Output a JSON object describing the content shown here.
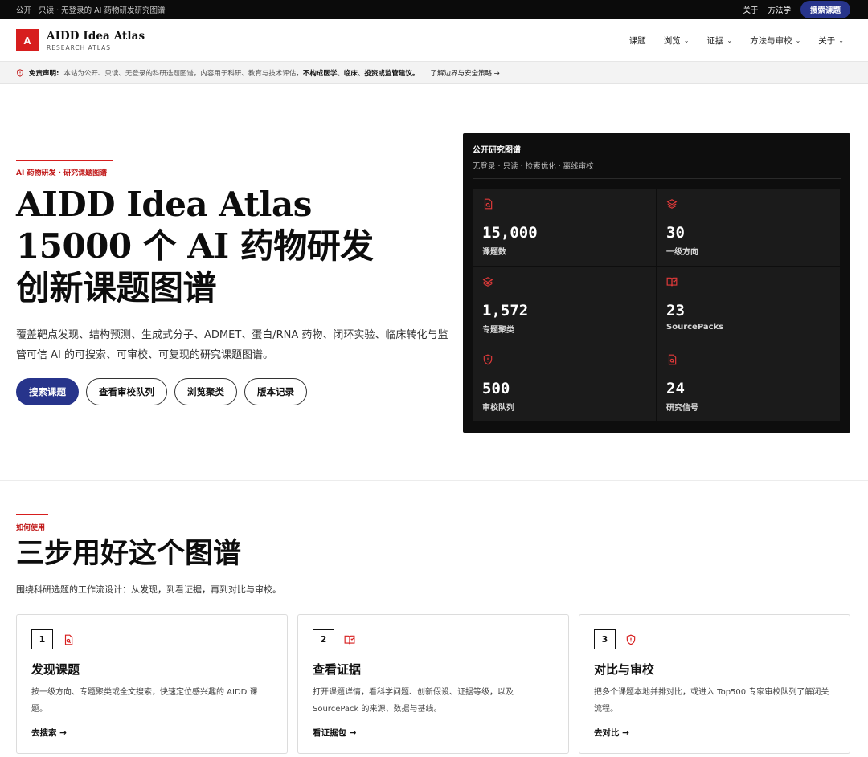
{
  "topbar": {
    "tagline": "公开 · 只读 · 无登录的 AI 药物研发研究图谱",
    "links": [
      "关于",
      "方法学"
    ],
    "search_button": "搜索课题"
  },
  "header": {
    "logo_letter": "A",
    "brand_name": "AIDD Idea Atlas",
    "brand_sub": "RESEARCH ATLAS",
    "nav": [
      {
        "label": "课题",
        "dropdown": false
      },
      {
        "label": "浏览",
        "dropdown": true
      },
      {
        "label": "证据",
        "dropdown": true
      },
      {
        "label": "方法与审校",
        "dropdown": true
      },
      {
        "label": "关于",
        "dropdown": true
      }
    ]
  },
  "disclaimer": {
    "label": "免责声明:",
    "text": "本站为公开、只读、无登录的科研选题图谱，内容用于科研、教育与技术评估，",
    "emphasis": "不构成医学、临床、投资或监管建议。",
    "link": "了解边界与安全策略 →"
  },
  "hero": {
    "kicker": "AI 药物研发 · 研究课题图谱",
    "title_line1": "AIDD Idea Atlas",
    "title_line2": "15000 个 AI 药物研发",
    "title_line3": "创新课题图谱",
    "description": "覆盖靶点发现、结构预测、生成式分子、ADMET、蛋白/RNA 药物、闭环实验、临床转化与监管可信 AI 的可搜索、可审校、可复现的研究课题图谱。",
    "buttons": [
      "搜索课题",
      "查看审校队列",
      "浏览聚类",
      "版本记录"
    ]
  },
  "panel": {
    "title": "公开研究图谱",
    "subtitle": "无登录 · 只读 · 检索优化 · 离线审校",
    "stats": [
      {
        "value": "15,000",
        "label": "课题数",
        "icon": "file-search-icon"
      },
      {
        "value": "30",
        "label": "一级方向",
        "icon": "layers-icon"
      },
      {
        "value": "1,572",
        "label": "专题聚类",
        "icon": "layers-icon"
      },
      {
        "value": "23",
        "label": "SourcePacks",
        "icon": "book-open-check-icon"
      },
      {
        "value": "500",
        "label": "审校队列",
        "icon": "shield-alert-icon"
      },
      {
        "value": "24",
        "label": "研究信号",
        "icon": "file-search-icon"
      }
    ]
  },
  "howto": {
    "kicker": "如何使用",
    "title": "三步用好这个图谱",
    "description": "围绕科研选题的工作流设计：从发现，到看证据，再到对比与审校。",
    "cards": [
      {
        "num": "1",
        "icon": "file-search-icon",
        "title": "发现课题",
        "desc": "按一级方向、专题聚类或全文搜索，快速定位感兴趣的 AIDD 课题。",
        "link": "去搜索 →"
      },
      {
        "num": "2",
        "icon": "book-open-check-icon",
        "title": "查看证据",
        "desc": "打开课题详情，看科学问题、创新假设、证据等级，以及 SourcePack 的来源、数据与基线。",
        "link": "看证据包 →"
      },
      {
        "num": "3",
        "icon": "shield-alert-icon",
        "title": "对比与审校",
        "desc": "把多个课题本地并排对比，或进入 Top500 专家审校队列了解闭关流程。",
        "link": "去对比 →"
      }
    ]
  },
  "colors": {
    "accent_red": "#d71e1e",
    "primary_blue": "#27348b",
    "panel_bg": "#0e0e0e"
  }
}
